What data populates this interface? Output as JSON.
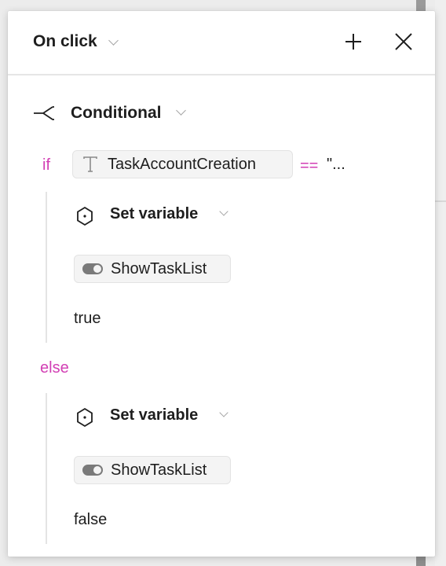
{
  "header": {
    "title": "On click",
    "add_icon": "plus-icon",
    "close_icon": "close-icon"
  },
  "action": {
    "label": "Conditional",
    "icon": "branch-icon"
  },
  "condition": {
    "keyword_if": "if",
    "variable_icon": "text-type-icon",
    "variable": "TaskAccountCreation",
    "operator": "==",
    "value": "\"..."
  },
  "if_branch": {
    "action_label": "Set variable",
    "action_icon": "variable-hexagon-icon",
    "variable_icon": "boolean-toggle-icon",
    "variable": "ShowTaskList",
    "value": "true"
  },
  "else_branch": {
    "keyword_else": "else",
    "action_label": "Set variable",
    "action_icon": "variable-hexagon-icon",
    "variable_icon": "boolean-toggle-icon",
    "variable": "ShowTaskList",
    "value": "false"
  },
  "colors": {
    "keyword": "#d23fb4",
    "text": "#1e1e1e",
    "pill_bg": "#f4f4f4"
  }
}
